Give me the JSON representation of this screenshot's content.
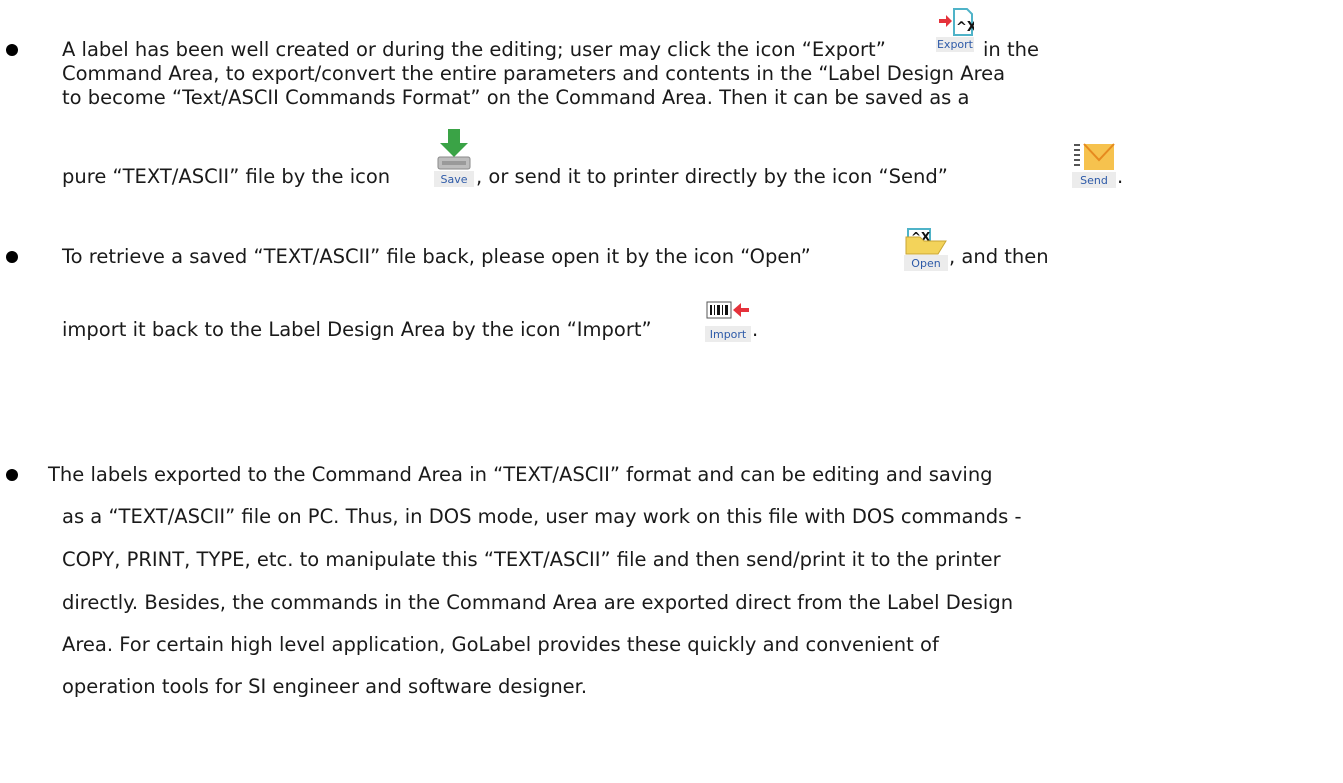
{
  "bullets": [
    {
      "lines": [
        "A label has been well created or during the editing; user may click the icon “Export”",
        "in the",
        "Command Area, to export/convert the entire parameters and contents in the “Label Design Area",
        "to become “Text/ASCII Commands Format” on the Command Area. Then it can be saved as a",
        "pure “TEXT/ASCII” file by the icon",
        ", or send it to printer directly by the icon “Send”",
        "."
      ]
    },
    {
      "lines": [
        "To retrieve a saved “TEXT/ASCII” file back, please open it by the icon “Open”",
        ", and then",
        "import it back to the Label Design Area by the icon “Import”",
        "."
      ]
    },
    {
      "lines": [
        "The labels exported to the Command Area in “TEXT/ASCII” format and can be editing and saving",
        "as a “TEXT/ASCII” file on PC. Thus, in DOS mode, user may work on this file with DOS commands -",
        "COPY, PRINT, TYPE, etc. to manipulate this “TEXT/ASCII” file and then send/print it to the printer",
        "directly. Besides, the commands in the Command Area are exported direct from the Label Design",
        "Area. For certain high level application, GoLabel provides these quickly and convenient of",
        "operation tools for SI engineer and software designer."
      ]
    }
  ],
  "icons": {
    "export": "Export",
    "save": "Save",
    "send": "Send",
    "open": "Open",
    "import": "Import"
  },
  "icon_art": {
    "export_glyph": "^X",
    "open_glyph": "^X"
  },
  "colors": {
    "icon_label": "#2d5aa8",
    "arrow_red": "#e5323b",
    "save_green": "#3aa346",
    "send_orange": "#f0a030",
    "folder_yellow": "#f3d35a",
    "doc_teal": "#4fb3c8"
  }
}
